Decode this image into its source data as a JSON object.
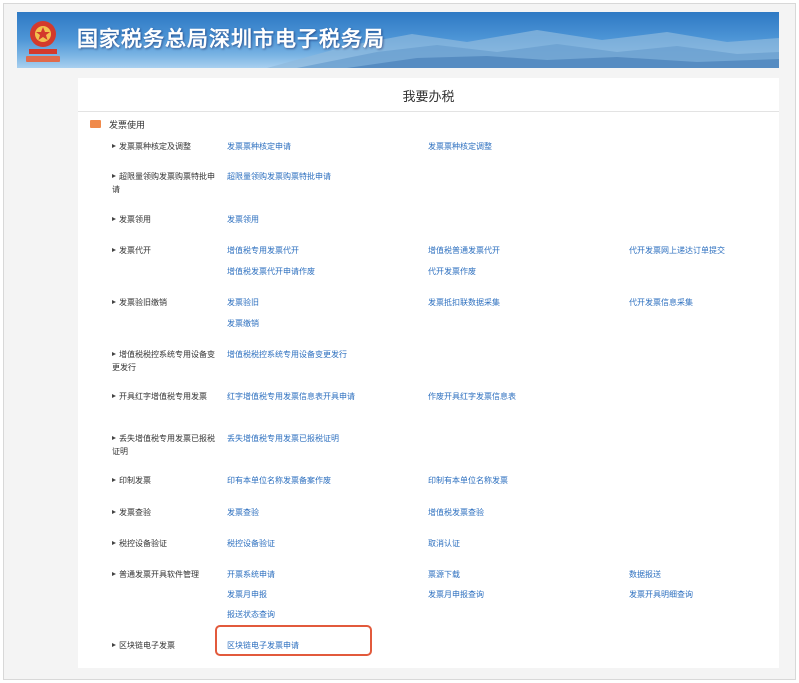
{
  "header": {
    "title": "国家税务总局深圳市电子税务局"
  },
  "page_title": "我要办税",
  "section": {
    "title": "发票使用",
    "rows": [
      {
        "label": "发票票种核定及调整",
        "links": [
          "发票票种核定申请",
          "发票票种核定调整"
        ]
      },
      {
        "label": "超限量领购发票购票特批申请",
        "links": [
          "超限量领购发票购票特批申请"
        ]
      },
      {
        "label": "发票领用",
        "links": [
          "发票领用"
        ]
      },
      {
        "label": "发票代开",
        "links": [
          "增值税专用发票代开",
          "增值税普通发票代开",
          "代开发票网上递达订单提交",
          "增值税发票代开申请作废",
          "代开发票作废"
        ]
      },
      {
        "label": "发票验旧缴销",
        "links": [
          "发票验旧",
          "发票抵扣联数据采集",
          "代开发票信息采集",
          "发票缴销"
        ]
      },
      {
        "label": "增值税税控系统专用设备变更发行",
        "links": [
          "增值税税控系统专用设备变更发行"
        ]
      },
      {
        "label": "开具红字增值税专用发票",
        "links": [
          "红字增值税专用发票信息表开具申请",
          "作废开具红字发票信息表"
        ]
      },
      {
        "label": "丢失增值税专用发票已报税证明",
        "links": [
          "丢失增值税专用发票已报税证明"
        ]
      },
      {
        "label": "印制发票",
        "links": [
          "印有本单位名称发票备案作废",
          "印制有本单位名称发票"
        ]
      },
      {
        "label": "发票查验",
        "links": [
          "发票查验",
          "增值税发票查验"
        ]
      },
      {
        "label": "税控设备验证",
        "links": [
          "税控设备验证",
          "取消认证"
        ]
      },
      {
        "label": "普通发票开具软件管理",
        "links": [
          "开票系统申请",
          "票源下载",
          "数据报送",
          "发票月申报",
          "发票月申报查询",
          "发票开具明细查询",
          "报送状态查询"
        ]
      },
      {
        "label": "区块链电子发票",
        "links": [
          "区块链电子发票申请"
        ]
      }
    ]
  },
  "colors": {
    "banner": "#3d86cc",
    "link": "#2c6fbf",
    "highlight": "#e25a3c",
    "section_icon": "#f08a4b"
  }
}
